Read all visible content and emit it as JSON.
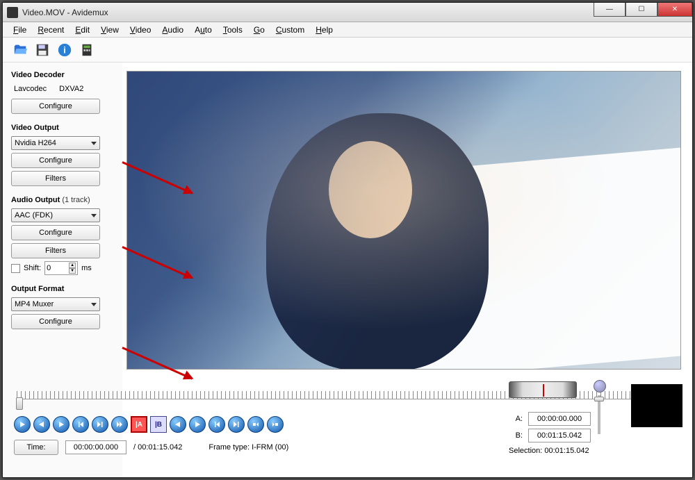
{
  "titlebar": {
    "title": "Video.MOV - Avidemux"
  },
  "menu": {
    "file": "File",
    "recent": "Recent",
    "edit": "Edit",
    "view": "View",
    "video": "Video",
    "audio": "Audio",
    "auto": "Auto",
    "tools": "Tools",
    "go": "Go",
    "custom": "Custom",
    "help": "Help"
  },
  "sidebar": {
    "decoder_h": "Video Decoder",
    "decoder1": "Lavcodec",
    "decoder2": "DXVA2",
    "configure": "Configure",
    "vout_h": "Video Output",
    "vout_sel": "Nvidia H264",
    "filters": "Filters",
    "aout_h": "Audio Output",
    "aout_tracks": "(1 track)",
    "aout_sel": "AAC (FDK)",
    "shift_lbl": "Shift:",
    "shift_val": "0",
    "shift_unit": "ms",
    "ofmt_h": "Output Format",
    "ofmt_sel": "MP4 Muxer"
  },
  "bottom": {
    "time_btn": "Time:",
    "time_cur": "00:00:00.000",
    "time_total": "/ 00:01:15.042",
    "frametype": "Frame type:  I-FRM (00)",
    "a_lbl": "A:",
    "a_val": "00:00:00.000",
    "b_lbl": "B:",
    "b_val": "00:01:15.042",
    "selection": "Selection: 00:01:15.042"
  }
}
